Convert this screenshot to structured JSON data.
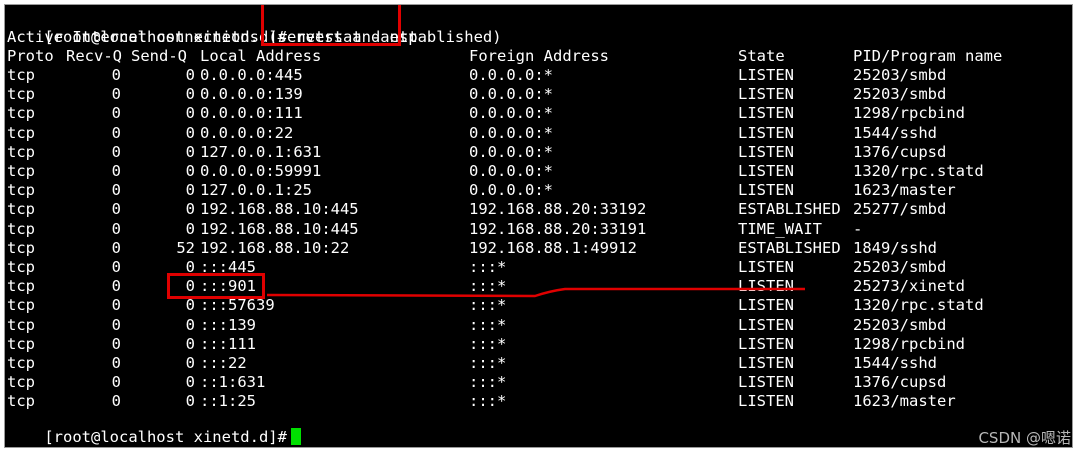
{
  "terminal": {
    "prompt": "[root@localhost xinetd.d]#",
    "command": "netstat -antp",
    "info_line": "Active Internet connections (servers and established)",
    "header": {
      "proto": "Proto",
      "recvq": "Recv-Q",
      "sendq": "Send-Q",
      "local": "Local Address",
      "foreign": "Foreign Address",
      "state": "State",
      "pid": "PID/Program name"
    },
    "rows": [
      {
        "proto": "tcp",
        "recvq": "0",
        "sendq": "0",
        "local": "0.0.0.0:445",
        "foreign": "0.0.0.0:*",
        "state": "LISTEN",
        "pid": "25203/smbd"
      },
      {
        "proto": "tcp",
        "recvq": "0",
        "sendq": "0",
        "local": "0.0.0.0:139",
        "foreign": "0.0.0.0:*",
        "state": "LISTEN",
        "pid": "25203/smbd"
      },
      {
        "proto": "tcp",
        "recvq": "0",
        "sendq": "0",
        "local": "0.0.0.0:111",
        "foreign": "0.0.0.0:*",
        "state": "LISTEN",
        "pid": "1298/rpcbind"
      },
      {
        "proto": "tcp",
        "recvq": "0",
        "sendq": "0",
        "local": "0.0.0.0:22",
        "foreign": "0.0.0.0:*",
        "state": "LISTEN",
        "pid": "1544/sshd"
      },
      {
        "proto": "tcp",
        "recvq": "0",
        "sendq": "0",
        "local": "127.0.0.1:631",
        "foreign": "0.0.0.0:*",
        "state": "LISTEN",
        "pid": "1376/cupsd"
      },
      {
        "proto": "tcp",
        "recvq": "0",
        "sendq": "0",
        "local": "0.0.0.0:59991",
        "foreign": "0.0.0.0:*",
        "state": "LISTEN",
        "pid": "1320/rpc.statd"
      },
      {
        "proto": "tcp",
        "recvq": "0",
        "sendq": "0",
        "local": "127.0.0.1:25",
        "foreign": "0.0.0.0:*",
        "state": "LISTEN",
        "pid": "1623/master"
      },
      {
        "proto": "tcp",
        "recvq": "0",
        "sendq": "0",
        "local": "192.168.88.10:445",
        "foreign": "192.168.88.20:33192",
        "state": "ESTABLISHED",
        "pid": "25277/smbd"
      },
      {
        "proto": "tcp",
        "recvq": "0",
        "sendq": "0",
        "local": "192.168.88.10:445",
        "foreign": "192.168.88.20:33191",
        "state": "TIME_WAIT",
        "pid": "-"
      },
      {
        "proto": "tcp",
        "recvq": "0",
        "sendq": "52",
        "local": "192.168.88.10:22",
        "foreign": "192.168.88.1:49912",
        "state": "ESTABLISHED",
        "pid": "1849/sshd"
      },
      {
        "proto": "tcp",
        "recvq": "0",
        "sendq": "0",
        "local": ":::445",
        "foreign": ":::*",
        "state": "LISTEN",
        "pid": "25203/smbd"
      },
      {
        "proto": "tcp",
        "recvq": "0",
        "sendq": "0",
        "local": ":::901",
        "foreign": ":::*",
        "state": "LISTEN",
        "pid": "25273/xinetd"
      },
      {
        "proto": "tcp",
        "recvq": "0",
        "sendq": "0",
        "local": ":::57639",
        "foreign": ":::*",
        "state": "LISTEN",
        "pid": "1320/rpc.statd"
      },
      {
        "proto": "tcp",
        "recvq": "0",
        "sendq": "0",
        "local": ":::139",
        "foreign": ":::*",
        "state": "LISTEN",
        "pid": "25203/smbd"
      },
      {
        "proto": "tcp",
        "recvq": "0",
        "sendq": "0",
        "local": ":::111",
        "foreign": ":::*",
        "state": "LISTEN",
        "pid": "1298/rpcbind"
      },
      {
        "proto": "tcp",
        "recvq": "0",
        "sendq": "0",
        "local": ":::22",
        "foreign": ":::*",
        "state": "LISTEN",
        "pid": "1544/sshd"
      },
      {
        "proto": "tcp",
        "recvq": "0",
        "sendq": "0",
        "local": "::1:631",
        "foreign": ":::*",
        "state": "LISTEN",
        "pid": "1376/cupsd"
      },
      {
        "proto": "tcp",
        "recvq": "0",
        "sendq": "0",
        "local": "::1:25",
        "foreign": ":::*",
        "state": "LISTEN",
        "pid": "1623/master"
      }
    ]
  },
  "colors": {
    "background": "#000000",
    "text": "#ffffff",
    "cursor": "#00e000",
    "annotation": "#e00000"
  },
  "watermark": "CSDN @嗯诺"
}
